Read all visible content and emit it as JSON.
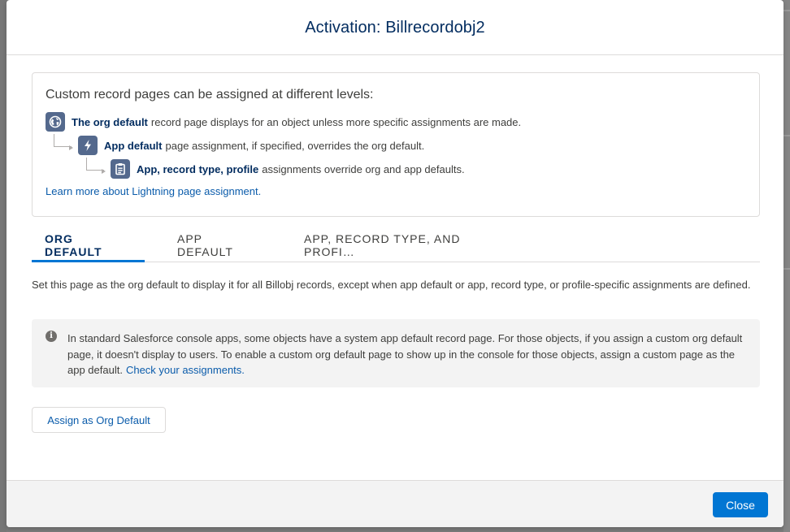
{
  "modal": {
    "title": "Activation: Billrecordobj2"
  },
  "info": {
    "heading": "Custom record pages can be assigned at different levels:",
    "levels": [
      {
        "bold": "The org default",
        "text": "record page displays for an object unless more specific assignments are made.",
        "icon": "globe-icon"
      },
      {
        "bold": "App default",
        "text": "page assignment, if specified, overrides the org default.",
        "icon": "lightning-bolt-icon"
      },
      {
        "bold": "App, record type, profile",
        "text": "assignments override org and app defaults.",
        "icon": "clipboard-icon"
      }
    ],
    "learn_more": "Learn more about Lightning page assignment."
  },
  "tabs": [
    {
      "label": "ORG DEFAULT",
      "active": true
    },
    {
      "label": "APP DEFAULT",
      "active": false
    },
    {
      "label": "APP, RECORD TYPE, AND PROFI…",
      "active": false
    }
  ],
  "description": "Set this page as the org default to display it for all Billobj records, except when app default or app, record type, or profile-specific assignments are defined.",
  "notice": {
    "text": "In standard Salesforce console apps, some objects have a system app default record page. For those objects, if you assign a custom org default page, it doesn't display to users. To enable a custom org default page to show up in the console for those objects, assign a custom page as the app default.",
    "link": "Check your assignments.",
    "icon": "info-icon"
  },
  "buttons": {
    "assign": "Assign as Org Default",
    "close": "Close"
  },
  "colors": {
    "brand": "#0176d3",
    "link": "#0b5cab",
    "title": "#032d60",
    "icon_bg": "#54698d"
  }
}
